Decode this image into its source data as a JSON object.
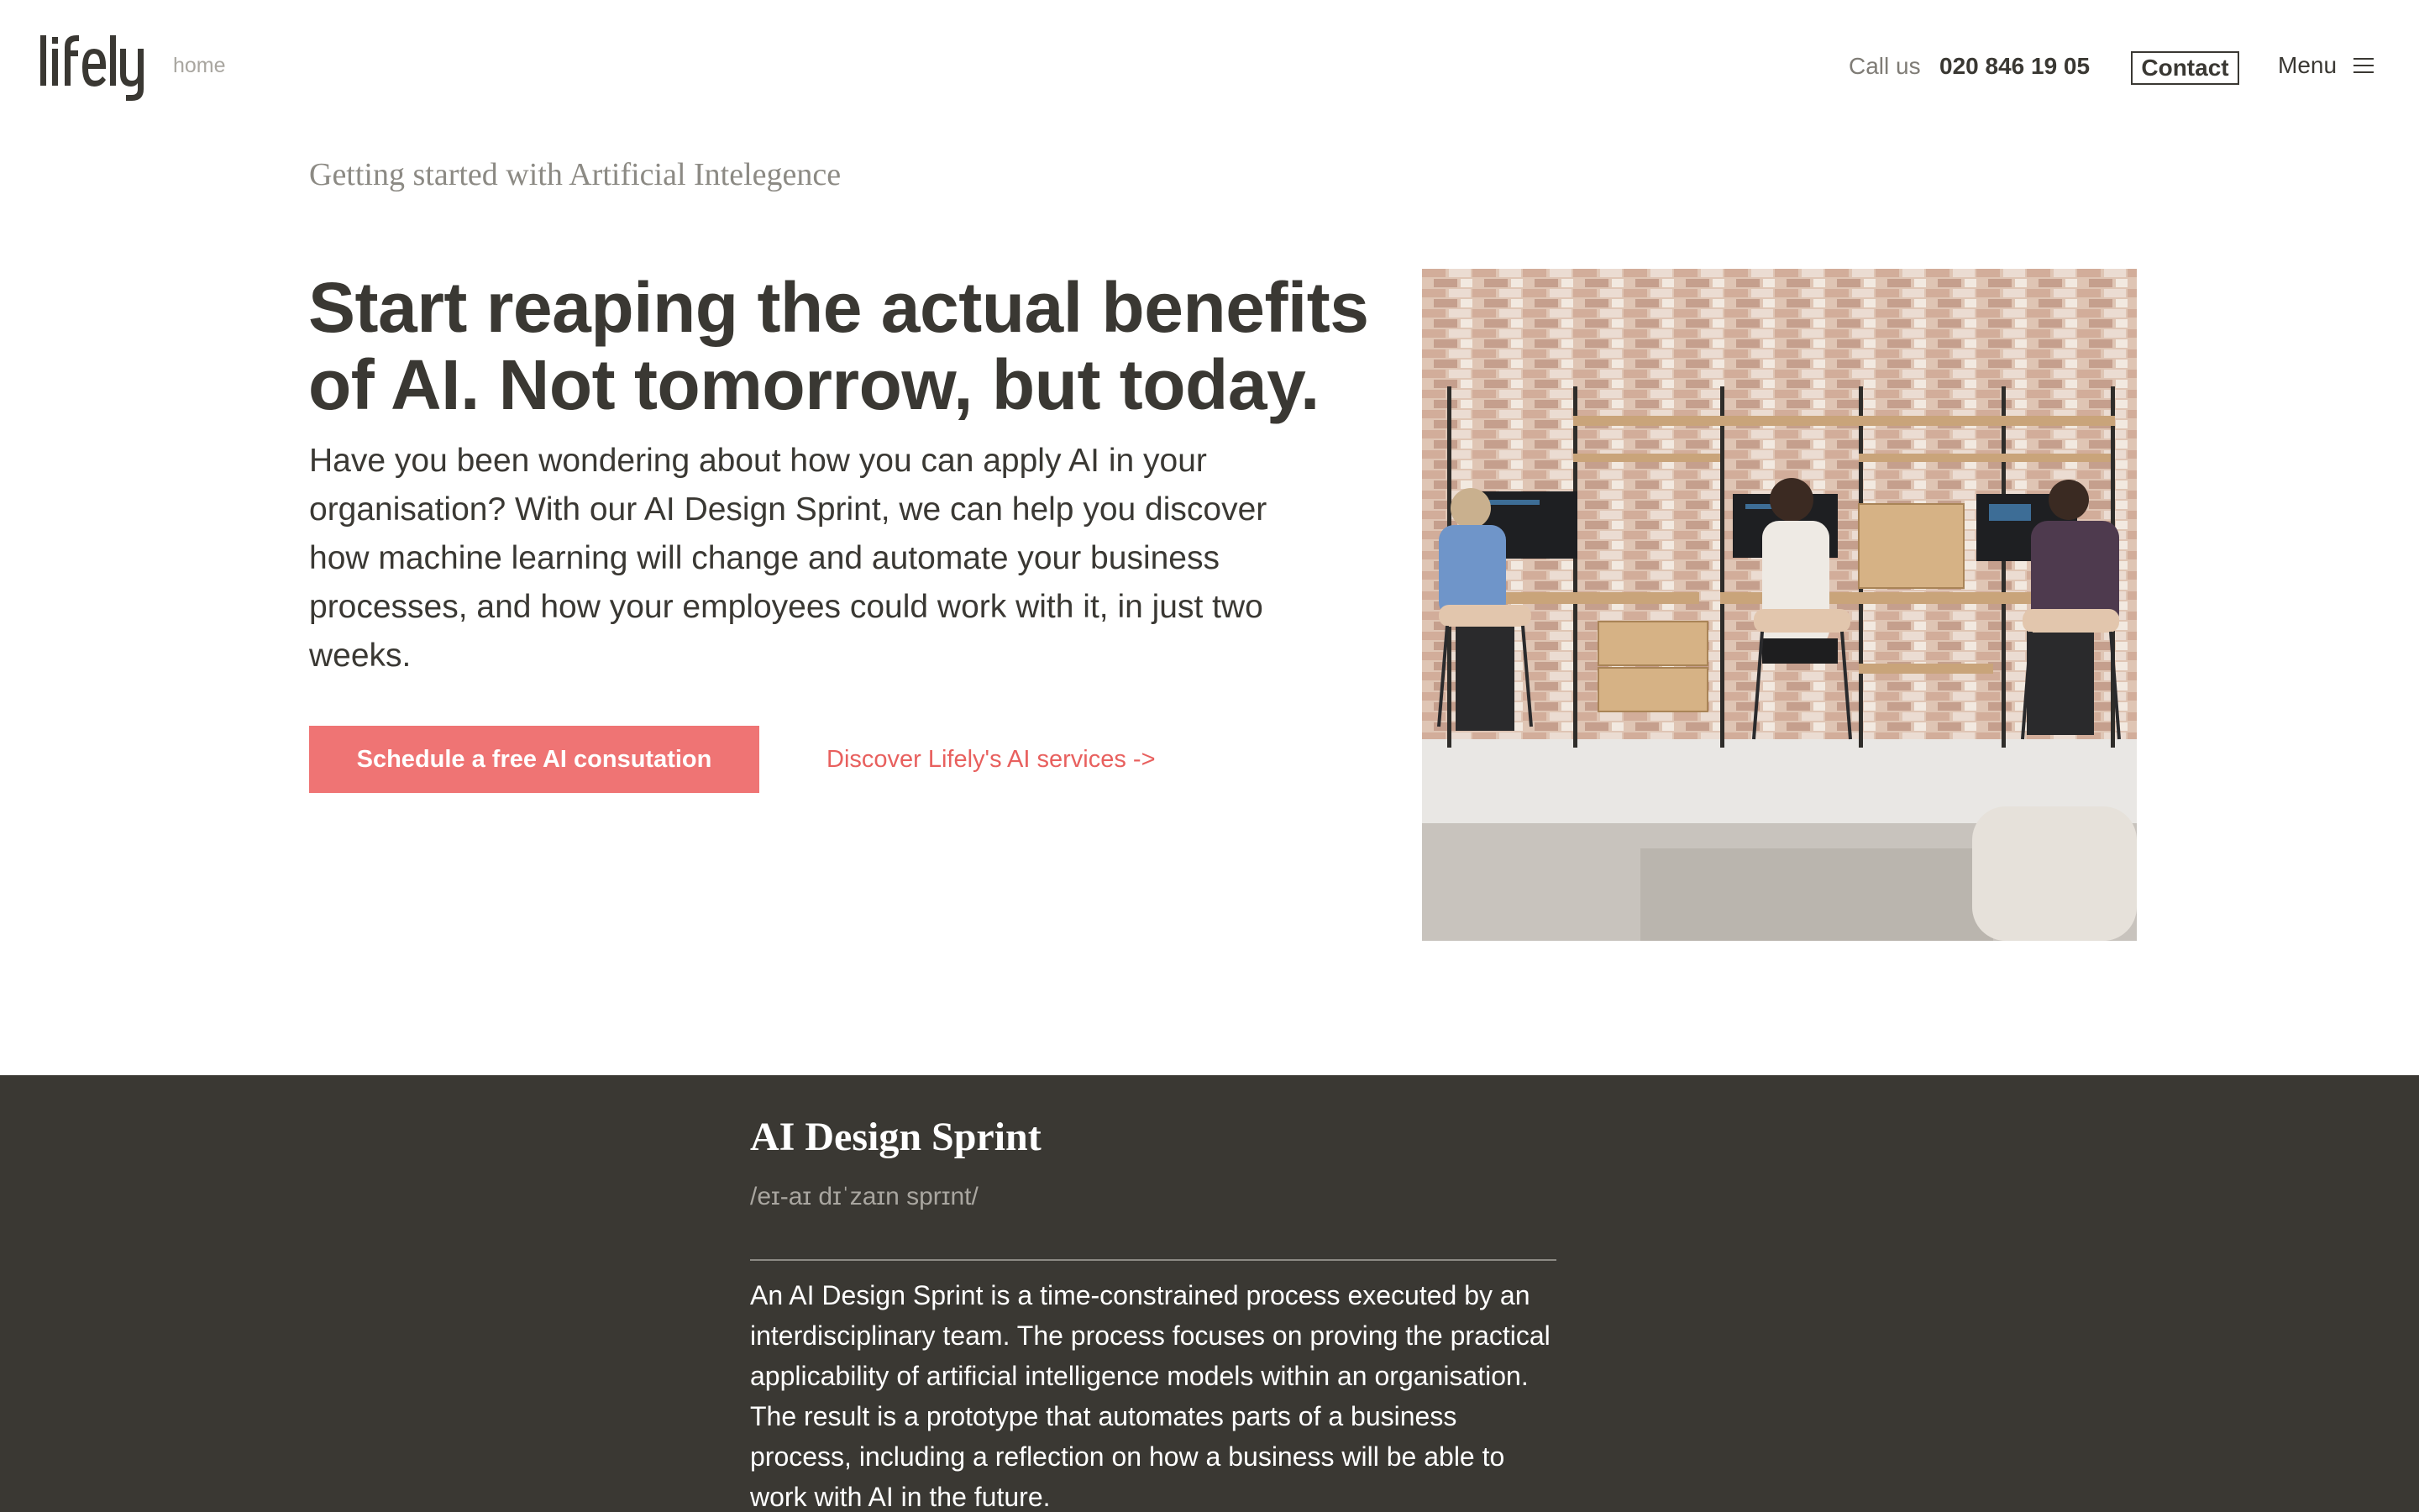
{
  "header": {
    "logo_text": "lifely",
    "breadcrumb": "home",
    "call_label": "Call us",
    "phone": "020 846 19 05",
    "contact_label": "Contact",
    "menu_label": "Menu"
  },
  "hero": {
    "eyebrow": "Getting started with Artificial Intelegence",
    "title": "Start reaping the actual benefits of AI. Not tomorrow, but today.",
    "body": "Have you been wondering about how you can apply AI in your organisation? With our AI Design Sprint, we can help you discover how machine learning will change and automate your business processes, and how your employees could work with it, in just two weeks.",
    "primary_cta": "Schedule a free AI consutation",
    "secondary_cta": "Discover Lifely's AI services ->"
  },
  "definition": {
    "title": "AI Design Sprint",
    "phonetic": "/eɪ-aɪ dɪˈzaɪn sprɪnt/",
    "body": "An AI Design Sprint is a time-constrained process executed by an interdisciplinary team. The process focuses on proving the practical applicability of artificial intelligence models within an organisation. The result is a prototype that automates parts of a business process, including a reflection on how a business will be able to work with AI in the future."
  },
  "colors": {
    "accent": "#ef7474",
    "link": "#e8605e",
    "dark_bg": "#3a3833",
    "text": "#3a3833"
  },
  "icons": {
    "menu": "hamburger-icon"
  }
}
